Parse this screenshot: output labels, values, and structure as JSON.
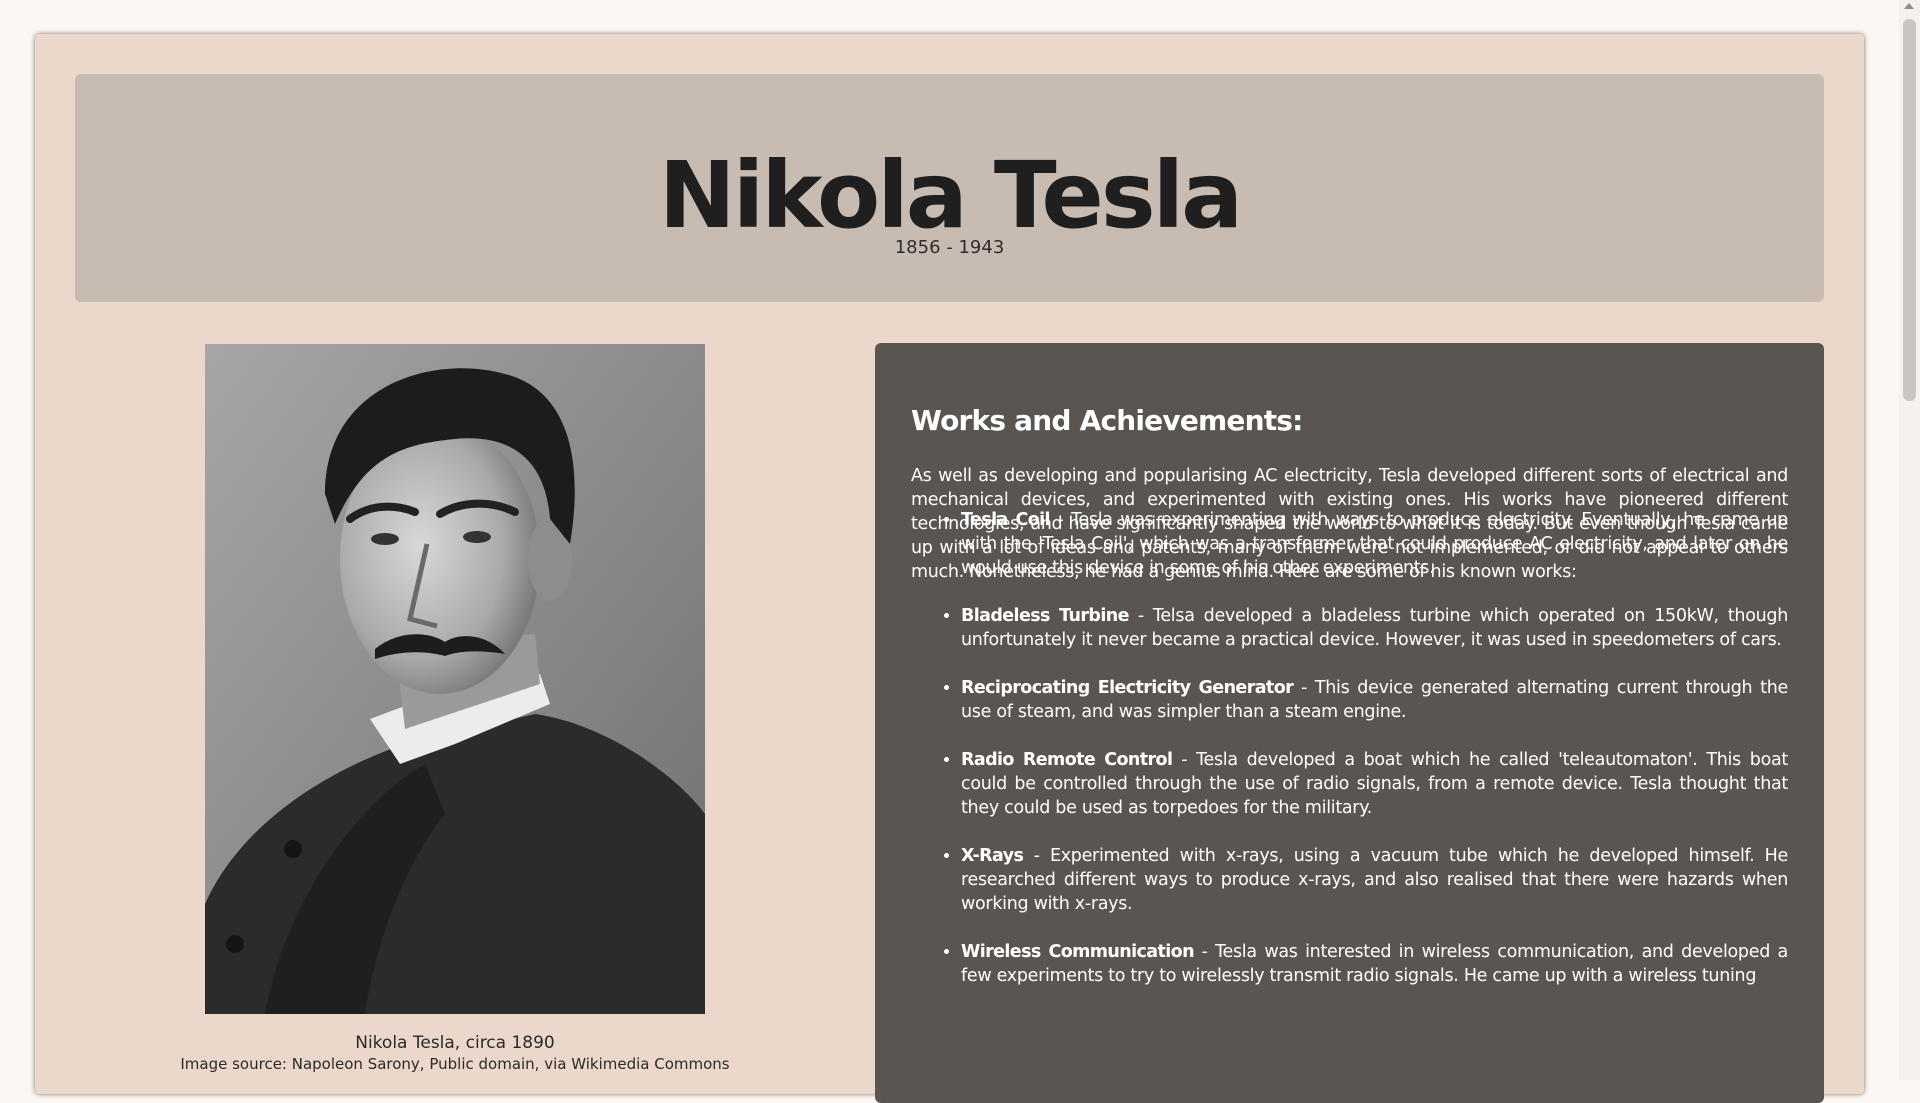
{
  "header": {
    "title": "Nikola Tesla",
    "dates": "1856 - 1943"
  },
  "portrait": {
    "caption": "Nikola Tesla, circa 1890",
    "caption_sub": "Image source: Napoleon Sarony, Public domain, via Wikimedia Commons"
  },
  "works": {
    "heading": "Works and Achievements:",
    "intro": "As well as developing and popularising AC electricity, Tesla developed different sorts of electrical and mechanical devices, and experimented with existing ones. His works have pioneered different technologies, and have significantly shaped the world to what it is today. But even though Tesla came up with a lot of ideas and patents, many of them were not implemented, or did not appeal to others much. Nonetheless, he had a genius mind. Here are some of his known works:",
    "items": [
      {
        "name": "Tesla Coil",
        "text": " - Tesla was experimenting with ways to produce electricity. Eventually, he came up with the 'Tesla Coil', which was a transformer that could produce AC electricity, and later on he would use this device in some of his other experiments."
      },
      {
        "name": "Bladeless Turbine",
        "text": " - Telsa developed a bladeless turbine which operated on 150kW, though unfortunately it never became a practical device. However, it was used in speedometers of cars."
      },
      {
        "name": "Reciprocating Electricity Generator",
        "text": " - This device generated alternating current through the use of steam, and was simpler than a steam engine."
      },
      {
        "name": "Radio Remote Control",
        "text": " - Tesla developed a boat which he called 'teleautomaton'. This boat could be controlled through the use of radio signals, from a remote device. Tesla thought that they could be used as torpedoes for the military."
      },
      {
        "name": "X-Rays",
        "text": " - Experimented with x-rays, using a vacuum tube which he developed himself. He researched different ways to produce x-rays, and also realised that there were hazards when working with x-rays."
      },
      {
        "name": "Wireless Communication",
        "text": " - Tesla was interested in wireless communication, and developed a few experiments to try to wirelessly transmit radio signals. He came up with a wireless tuning"
      }
    ]
  },
  "colors": {
    "page_bg": "#fdf7f3",
    "card_bg": "#ebd8ca",
    "header_bg": "#c8bbb2",
    "panel_bg": "#5a5550"
  },
  "icons": {
    "scroll_up": "scroll-up-arrow-icon"
  }
}
